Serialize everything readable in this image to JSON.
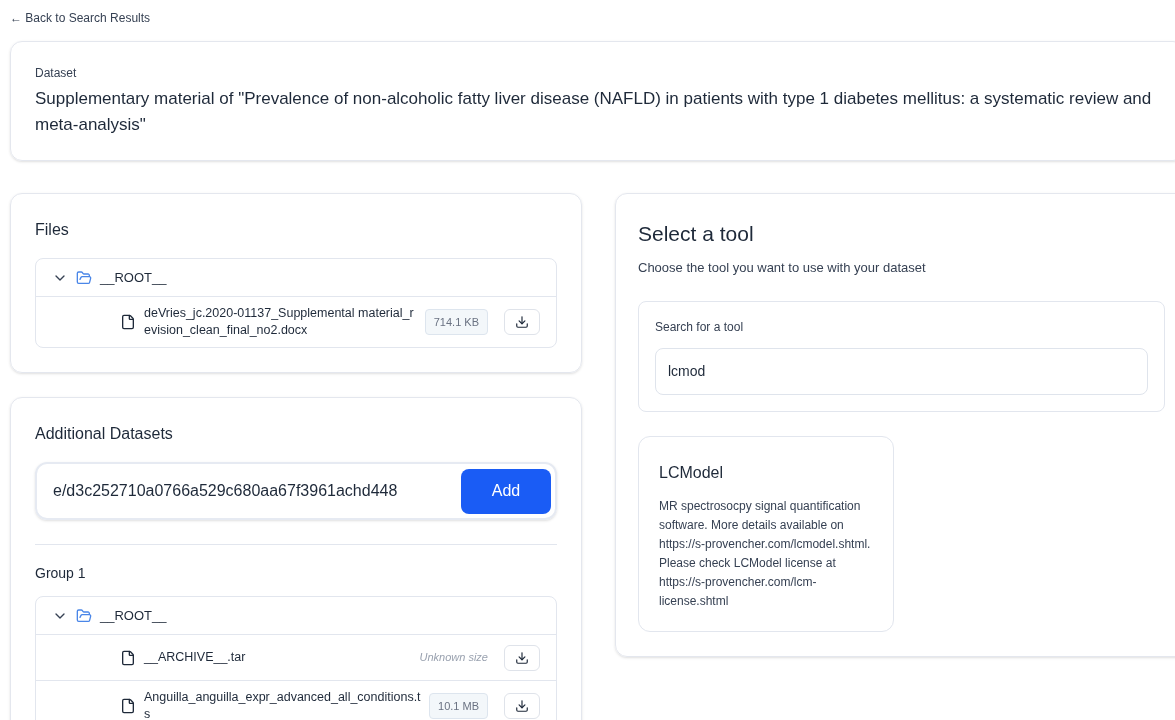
{
  "back_link": "← Back to Search Results",
  "dataset": {
    "label": "Dataset",
    "title": "Supplementary material of \"Prevalence of non-alcoholic fatty liver disease (NAFLD) in patients with type 1 diabetes mellitus: a systematic review and meta-analysis\""
  },
  "files": {
    "title": "Files",
    "tree": {
      "name": "__ROOT__",
      "expanded": true,
      "children": [
        {
          "name": "deVries_jc.2020-01137_Supplemental material_revision_clean_final_no2.docx",
          "size": "714.1 KB",
          "kind": "badge"
        }
      ]
    }
  },
  "additional_datasets": {
    "title": "Additional Datasets",
    "input_value": "e/d3c252710a0766a529c680aa67f3961achd448",
    "add_button": "Add",
    "groups": [
      {
        "title": "Group 1",
        "tree": {
          "name": "__ROOT__",
          "expanded": true,
          "children": [
            {
              "name": "__ARCHIVE__.tar",
              "size": "Unknown size",
              "kind": "unknown"
            },
            {
              "name": "Anguilla_anguilla_expr_advanced_all_conditions.ts",
              "size": "10.1 MB",
              "kind": "badge"
            }
          ]
        }
      }
    ]
  },
  "tool_panel": {
    "title": "Select a tool",
    "subtitle": "Choose the tool you want to use with your dataset",
    "search_label": "Search for a tool",
    "search_value": "lcmod",
    "results": [
      {
        "name": "LCModel",
        "description": "MR spectrosocpy signal quantification software. More details available on https://s-provencher.com/lcmodel.shtml. Please check LCModel license at https://s-provencher.com/lcm-license.shtml"
      }
    ]
  }
}
